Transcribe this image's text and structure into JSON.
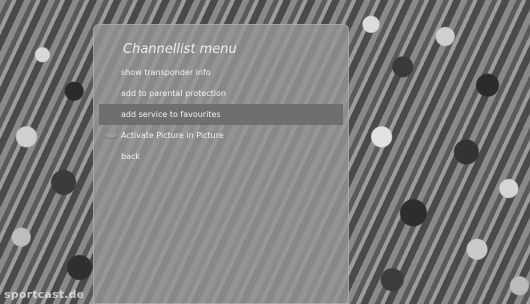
{
  "watermark": "sportcast.de",
  "menu": {
    "title": "Channellist menu",
    "items": [
      {
        "label": "show transponder info",
        "selected": false,
        "icon": ""
      },
      {
        "label": "add to parental protection",
        "selected": false,
        "icon": ""
      },
      {
        "label": "add service to favourites",
        "selected": true,
        "icon": ""
      },
      {
        "label": "Activate Picture in Picture",
        "selected": false,
        "icon": "color-key-icon"
      },
      {
        "label": "back",
        "selected": false,
        "icon": ""
      }
    ]
  },
  "colors": {
    "selection": "#6f6f6f",
    "panel": "#969696"
  }
}
